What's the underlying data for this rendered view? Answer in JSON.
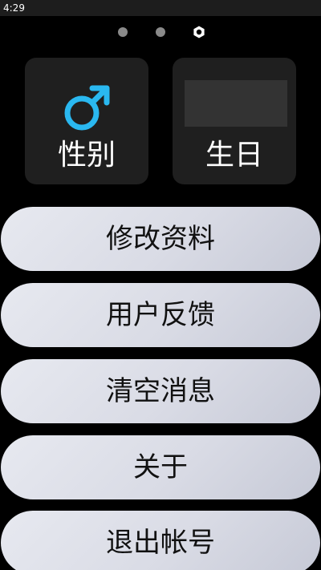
{
  "status_bar": {
    "time": "4:29"
  },
  "page_indicator": {
    "count": 3,
    "active_index": 2,
    "active_icon": "settings-hexagon-icon"
  },
  "tiles": {
    "gender": {
      "label": "性别",
      "icon": "male-icon",
      "icon_color": "#2ab8f0"
    },
    "birthday": {
      "label": "生日"
    }
  },
  "menu": {
    "edit_profile": "修改资料",
    "feedback": "用户反馈",
    "clear_messages": "清空消息",
    "about": "关于",
    "logout": "退出帐号"
  },
  "colors": {
    "background": "#000000",
    "tile": "#1f1f1f",
    "button_light": "#e7e9f0",
    "button_dark": "#c6c9d6"
  }
}
